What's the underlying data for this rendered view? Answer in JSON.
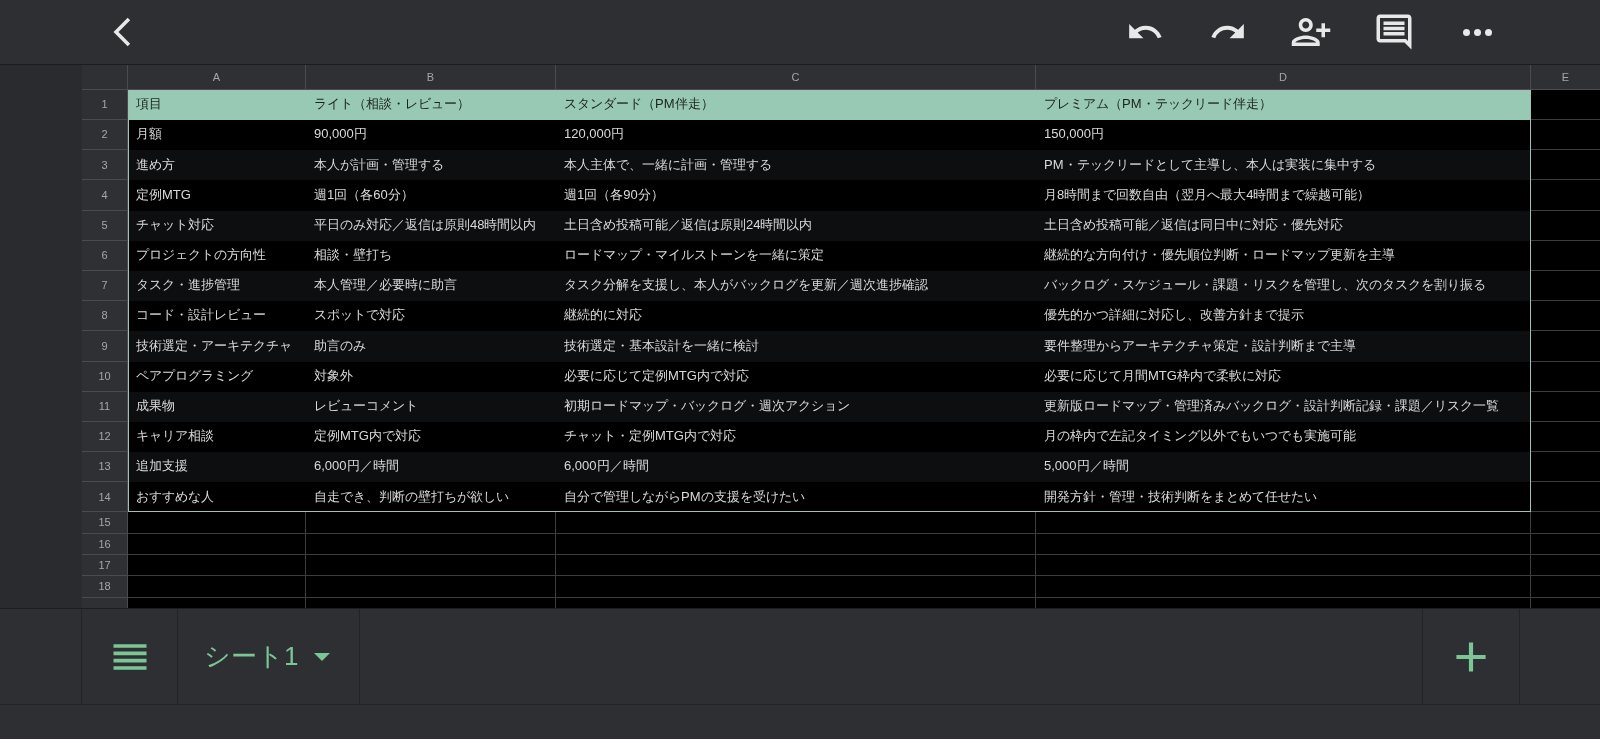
{
  "sheet": {
    "columns": [
      "A",
      "B",
      "C",
      "D",
      "E"
    ],
    "rows": [
      {
        "number": "1",
        "kind": "header",
        "cells": [
          "項目",
          "ライト（相談・レビュー）",
          "スタンダード（PM伴走）",
          "プレミアム（PM・テックリード伴走）"
        ]
      },
      {
        "number": "2",
        "kind": "data",
        "cells": [
          "月額",
          "90,000円",
          "120,000円",
          "150,000円"
        ]
      },
      {
        "number": "3",
        "kind": "data",
        "cells": [
          "進め方",
          "本人が計画・管理する",
          "本人主体で、一緒に計画・管理する",
          "PM・テックリードとして主導し、本人は実装に集中する"
        ]
      },
      {
        "number": "4",
        "kind": "data",
        "cells": [
          "定例MTG",
          "週1回（各60分）",
          "週1回（各90分）",
          "月8時間まで回数自由（翌月へ最大4時間まで繰越可能）"
        ]
      },
      {
        "number": "5",
        "kind": "data",
        "cells": [
          "チャット対応",
          "平日のみ対応／返信は原則48時間以内",
          "土日含め投稿可能／返信は原則24時間以内",
          "土日含め投稿可能／返信は同日中に対応・優先対応"
        ]
      },
      {
        "number": "6",
        "kind": "data",
        "cells": [
          "プロジェクトの方向性",
          "相談・壁打ち",
          "ロードマップ・マイルストーンを一緒に策定",
          "継続的な方向付け・優先順位判断・ロードマップ更新を主導"
        ]
      },
      {
        "number": "7",
        "kind": "data",
        "cells": [
          "タスク・進捗管理",
          "本人管理／必要時に助言",
          "タスク分解を支援し、本人がバックログを更新／週次進捗確認",
          "バックログ・スケジュール・課題・リスクを管理し、次のタスクを割り振る"
        ]
      },
      {
        "number": "8",
        "kind": "data",
        "cells": [
          "コード・設計レビュー",
          "スポットで対応",
          "継続的に対応",
          "優先的かつ詳細に対応し、改善方針まで提示"
        ]
      },
      {
        "number": "9",
        "kind": "data",
        "cells": [
          "技術選定・アーキテクチャ",
          "助言のみ",
          "技術選定・基本設計を一緒に検討",
          "要件整理からアーキテクチャ策定・設計判断まで主導"
        ]
      },
      {
        "number": "10",
        "kind": "data",
        "cells": [
          "ペアプログラミング",
          "対象外",
          "必要に応じて定例MTG内で対応",
          "必要に応じて月間MTG枠内で柔軟に対応"
        ]
      },
      {
        "number": "11",
        "kind": "data",
        "cells": [
          "成果物",
          "レビューコメント",
          "初期ロードマップ・バックログ・週次アクション",
          "更新版ロードマップ・管理済みバックログ・設計判断記録・課題／リスク一覧"
        ]
      },
      {
        "number": "12",
        "kind": "data",
        "cells": [
          "キャリア相談",
          "定例MTG内で対応",
          "チャット・定例MTG内で対応",
          "月の枠内で左記タイミング以外でもいつでも実施可能"
        ]
      },
      {
        "number": "13",
        "kind": "data",
        "cells": [
          "追加支援",
          "6,000円／時間",
          "6,000円／時間",
          "5,000円／時間"
        ]
      },
      {
        "number": "14",
        "kind": "data",
        "cells": [
          "おすすめな人",
          "自走でき、判断の壁打ちが欲しい",
          "自分で管理しながらPMの支援を受けたい",
          "開発方針・管理・技術判断をまとめて任せたい"
        ]
      },
      {
        "number": "15",
        "kind": "empty"
      },
      {
        "number": "16",
        "kind": "empty"
      },
      {
        "number": "17",
        "kind": "empty"
      },
      {
        "number": "18",
        "kind": "empty"
      }
    ]
  },
  "sheet_tabs": [
    {
      "name": "シート1",
      "selected": true
    }
  ]
}
